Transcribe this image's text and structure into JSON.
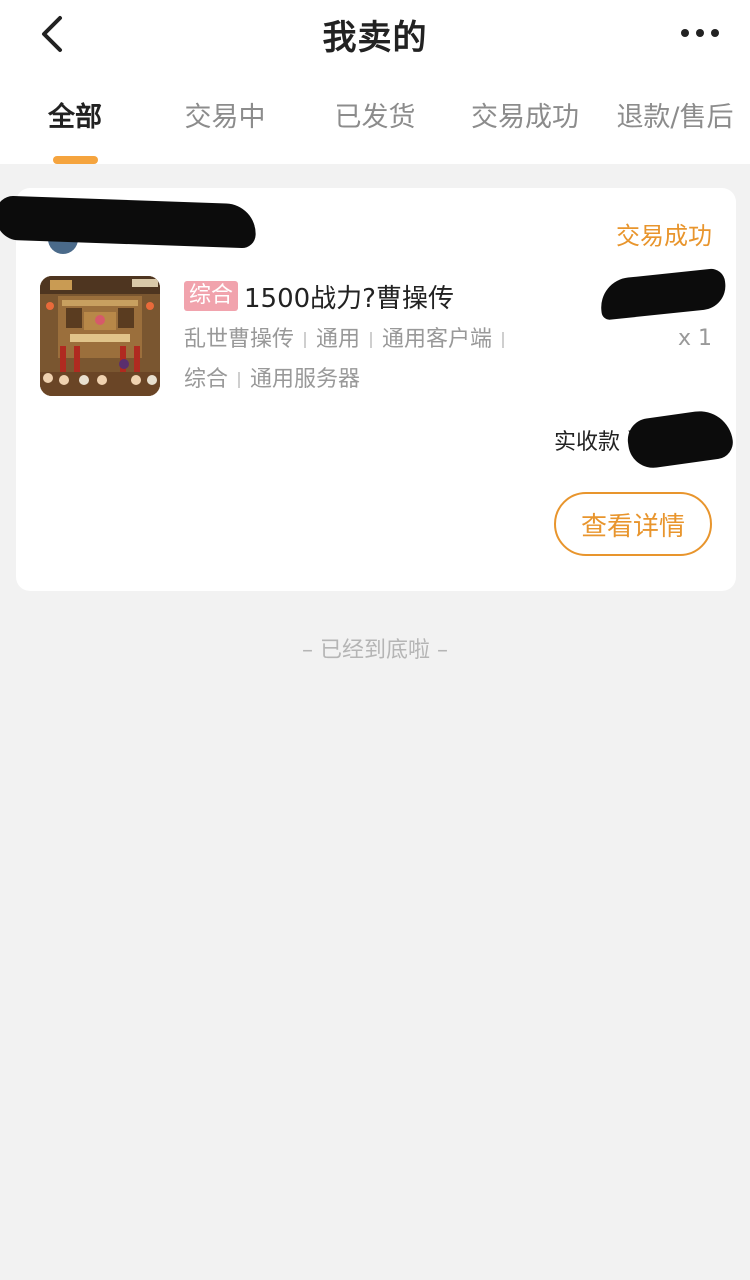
{
  "header": {
    "title": "我卖的"
  },
  "tabs": [
    {
      "label": "全部",
      "active": true
    },
    {
      "label": "交易中",
      "active": false
    },
    {
      "label": "已发货",
      "active": false
    },
    {
      "label": "交易成功",
      "active": false
    },
    {
      "label": "退款/售后",
      "active": false
    }
  ],
  "order": {
    "buyer_name": "",
    "status": "交易成功",
    "category_tag": "综合",
    "title": "1500战力?曹操传",
    "attributes": [
      "乱世曹操传",
      "通用",
      "通用客户端",
      "综合",
      "通用服务器"
    ],
    "quantity": "x 1",
    "received_label": "实收款",
    "received_amount": "¥",
    "detail_button": "查看详情"
  },
  "footer": {
    "end_text": "– 已经到底啦 –"
  },
  "colors": {
    "accent": "#f5a43e",
    "status_orange": "#e8952d",
    "tag_pink": "#f1a3ad",
    "background": "#f2f2f2"
  },
  "icons": {
    "back": "chevron-left-icon",
    "more": "more-horizontal-icon"
  }
}
